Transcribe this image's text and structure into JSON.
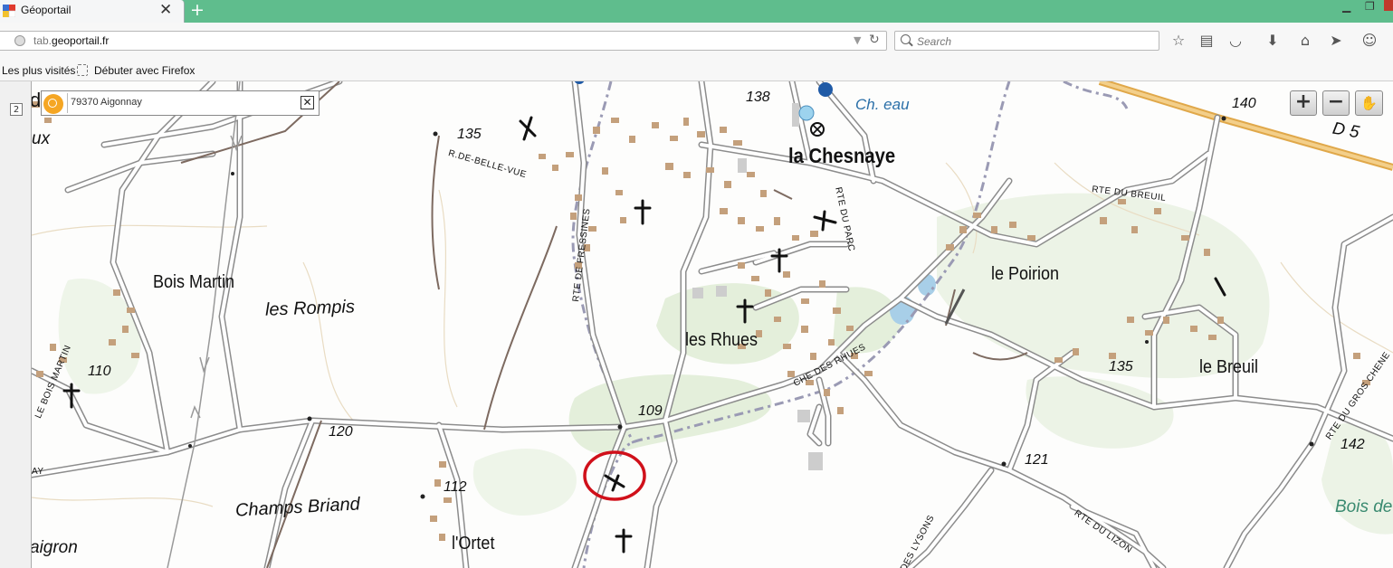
{
  "browser": {
    "tab_title": "Géoportail",
    "tab_close": "✕",
    "new_tab": "+",
    "url_scheme_host": "tab.",
    "url_domain": "geoportail.fr",
    "search_placeholder": "Search",
    "bookmarks": [
      "Les plus visités",
      "Débuter avec Firefox"
    ]
  },
  "page_indicator": "2",
  "location_search": {
    "value": "79370 Aigonnay",
    "close": "✕"
  },
  "map_controls": {
    "zoom_in": "+",
    "zoom_out": "−",
    "pan": "✋"
  },
  "map_labels": {
    "places": [
      "la Chesnaye",
      "Bois Martin",
      "les Rompis",
      "le Poirion",
      "les Rhues",
      "le Breuil",
      "Champs Briand",
      "l'Ortet"
    ],
    "partial_places": [
      "d",
      "ux",
      "aigron"
    ],
    "water": "Ch. eau",
    "wood": "Bois de",
    "road_number": "D 5",
    "altitudes": [
      "138",
      "140",
      "135",
      "110",
      "109",
      "120",
      "112",
      "121",
      "135",
      "142"
    ],
    "roads": [
      "R.DE-BELLE-VUE",
      "RTE DE FRESSINES",
      "RTE DU PARC",
      "RTE DU BREUIL",
      "CHE DES RHUES",
      "RTE DU LIZON",
      "DES LYSONS",
      "RTE DU GROS CHENE",
      "LE BOIS MARTIN",
      "AY"
    ]
  },
  "colors": {
    "tabbar": "#5fbd8d",
    "road_d5": "#e0a84a",
    "forest": "#dbead0",
    "building": "#c4a07c",
    "railway": "#9a9ab4",
    "water": "#a8cfe8",
    "highlight_circle": "#d0101a"
  }
}
